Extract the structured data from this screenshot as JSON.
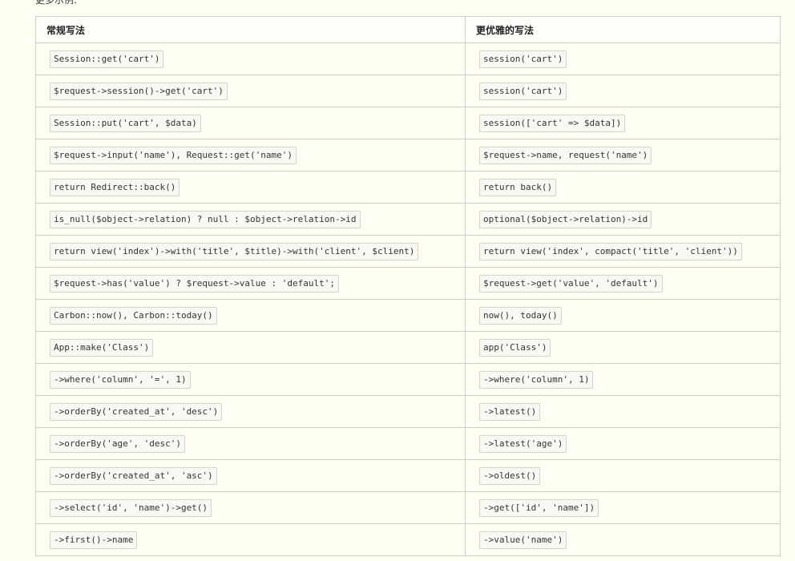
{
  "intro_text": "更多示例:",
  "table": {
    "headers": [
      "常规写法",
      "更优雅的写法"
    ],
    "rows": [
      [
        "Session::get('cart')",
        "session('cart')"
      ],
      [
        "$request->session()->get('cart')",
        "session('cart')"
      ],
      [
        "Session::put('cart', $data)",
        "session(['cart' => $data])"
      ],
      [
        "$request->input('name'), Request::get('name')",
        "$request->name, request('name')"
      ],
      [
        "return Redirect::back()",
        "return back()"
      ],
      [
        "is_null($object->relation) ? null : $object->relation->id",
        "optional($object->relation)->id"
      ],
      [
        "return view('index')->with('title', $title)->with('client', $client)",
        "return view('index', compact('title', 'client'))"
      ],
      [
        "$request->has('value') ? $request->value : 'default';",
        "$request->get('value', 'default')"
      ],
      [
        "Carbon::now(), Carbon::today()",
        "now(), today()"
      ],
      [
        "App::make('Class')",
        "app('Class')"
      ],
      [
        "->where('column', '=', 1)",
        "->where('column', 1)"
      ],
      [
        "->orderBy('created_at', 'desc')",
        "->latest()"
      ],
      [
        "->orderBy('age', 'desc')",
        "->latest('age')"
      ],
      [
        "->orderBy('created_at', 'asc')",
        "->oldest()"
      ],
      [
        "->select('id', 'name')->get()",
        "->get(['id', 'name'])"
      ],
      [
        "->first()->name",
        "->value('name')"
      ]
    ]
  }
}
